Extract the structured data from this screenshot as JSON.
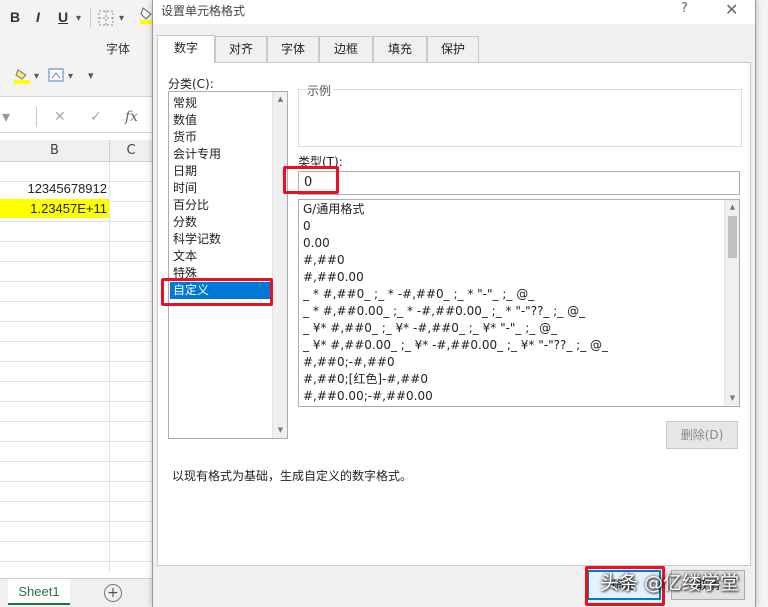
{
  "excel": {
    "ribbon": {
      "bold": "B",
      "italic": "I",
      "underline": "U",
      "font_group_label": "字体"
    },
    "formula_bar": {
      "cancel_glyph": "✕",
      "confirm_glyph": "✓",
      "fx": "fx"
    },
    "columns": [
      "B",
      "C"
    ],
    "cells": {
      "b1": "12345678912",
      "b2": "1.23457E+11"
    },
    "sheet_tab": "Sheet1",
    "add_sheet_glyph": "+",
    "colors": {
      "highlight_yellow": "#ffff00",
      "excel_green": "#217346"
    }
  },
  "dialog": {
    "title": "设置单元格格式",
    "help": "?",
    "close": "✕",
    "tabs": [
      "数字",
      "对齐",
      "字体",
      "边框",
      "填充",
      "保护"
    ],
    "active_tab": "数字",
    "category_label": "分类(C):",
    "categories": [
      "常规",
      "数值",
      "货币",
      "会计专用",
      "日期",
      "时间",
      "百分比",
      "分数",
      "科学记数",
      "文本",
      "特殊",
      "自定义"
    ],
    "selected_category": "自定义",
    "sample_label": "示例",
    "type_label": "类型(T):",
    "type_value": "0",
    "formats": [
      "G/通用格式",
      "0",
      "0.00",
      "#,##0",
      "#,##0.00",
      "_ * #,##0_ ;_ * -#,##0_ ;_ * \"-\"_ ;_ @_",
      "_ * #,##0.00_ ;_ * -#,##0.00_ ;_ * \"-\"??_ ;_ @_",
      "_ ¥* #,##0_ ;_ ¥* -#,##0_ ;_ ¥* \"-\"_ ;_ @_",
      "_ ¥* #,##0.00_ ;_ ¥* -#,##0.00_ ;_ ¥* \"-\"??_ ;_ @_",
      "#,##0;-#,##0",
      "#,##0;[红色]-#,##0",
      "#,##0.00;-#,##0.00"
    ],
    "delete_button": "删除(D)",
    "description": "以现有格式为基础，生成自定义的数字格式。",
    "ok_button": "确定",
    "cancel_button": "取消",
    "colors": {
      "selection_blue": "#0078d7",
      "annotation_red": "#e81123"
    }
  },
  "watermark": "头条 @亿缕学堂"
}
